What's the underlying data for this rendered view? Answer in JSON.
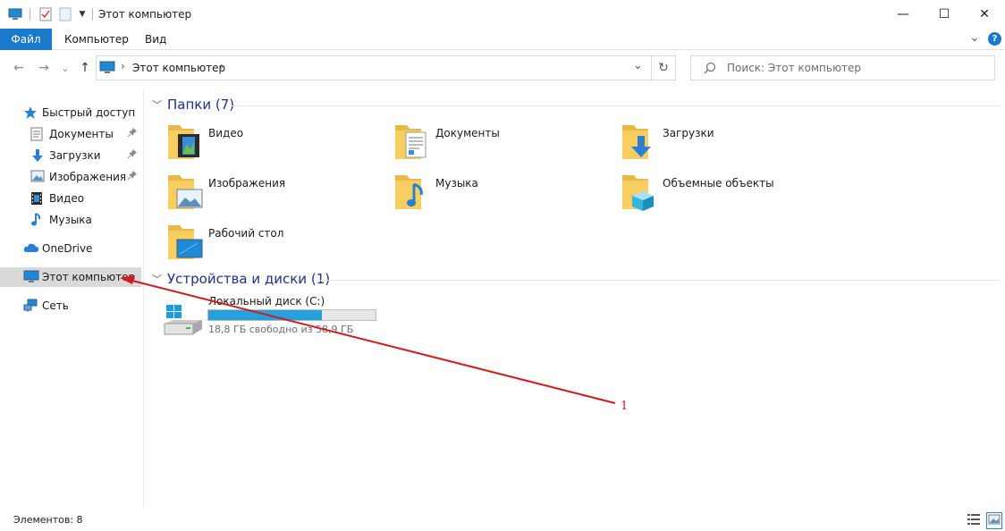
{
  "window": {
    "title": "Этот компьютер",
    "minimize_glyph": "—",
    "maximize_glyph": "☐",
    "close_glyph": "✕"
  },
  "ribbon": {
    "tabs": [
      {
        "label": "Файл"
      },
      {
        "label": "Компьютер"
      },
      {
        "label": "Вид"
      }
    ],
    "expand_glyph": "⌄",
    "help_glyph": "?"
  },
  "nav": {
    "back_glyph": "←",
    "forward_glyph": "→",
    "recent_glyph": "⌄",
    "up_glyph": "↑",
    "address_crumb": "Этот компьютер",
    "crumb_sep": "›",
    "address_dropdown": "⌄",
    "refresh_glyph": "↻",
    "search_placeholder": "Поиск: Этот компьютер"
  },
  "sidebar": {
    "quick_access": "Быстрый доступ",
    "items": [
      {
        "label": "Документы",
        "icon": "documents-icon",
        "pinned": true
      },
      {
        "label": "Загрузки",
        "icon": "downloads-icon",
        "pinned": true
      },
      {
        "label": "Изображения",
        "icon": "pictures-icon",
        "pinned": true
      },
      {
        "label": "Видео",
        "icon": "video-icon",
        "pinned": false
      },
      {
        "label": "Музыка",
        "icon": "music-icon",
        "pinned": false
      }
    ],
    "onedrive": "OneDrive",
    "this_pc": "Этот компьютер",
    "network": "Сеть",
    "pin_glyph": "📌"
  },
  "content": {
    "folders_header": "Папки (7)",
    "folders": [
      {
        "label": "Видео",
        "overlay": "video"
      },
      {
        "label": "Документы",
        "overlay": "documents"
      },
      {
        "label": "Загрузки",
        "overlay": "downloads"
      },
      {
        "label": "Изображения",
        "overlay": "pictures"
      },
      {
        "label": "Музыка",
        "overlay": "music"
      },
      {
        "label": "Объемные объекты",
        "overlay": "3d"
      },
      {
        "label": "Рабочий стол",
        "overlay": "desktop"
      }
    ],
    "devices_header": "Устройства и диски (1)",
    "disk": {
      "label": "Локальный диск (C:)",
      "free_text": "18,8 ГБ свободно из 58,9 ГБ",
      "used_fraction": 0.68
    }
  },
  "status": {
    "items_count": "Элементов: 8"
  },
  "annotation": {
    "number": "1",
    "color": "#d11c1c"
  },
  "colors": {
    "accent": "#1979ca",
    "folder_yellow": "#f7cf61",
    "disk_fill": "#26a0da",
    "selected_bg": "#d9d9d9"
  }
}
